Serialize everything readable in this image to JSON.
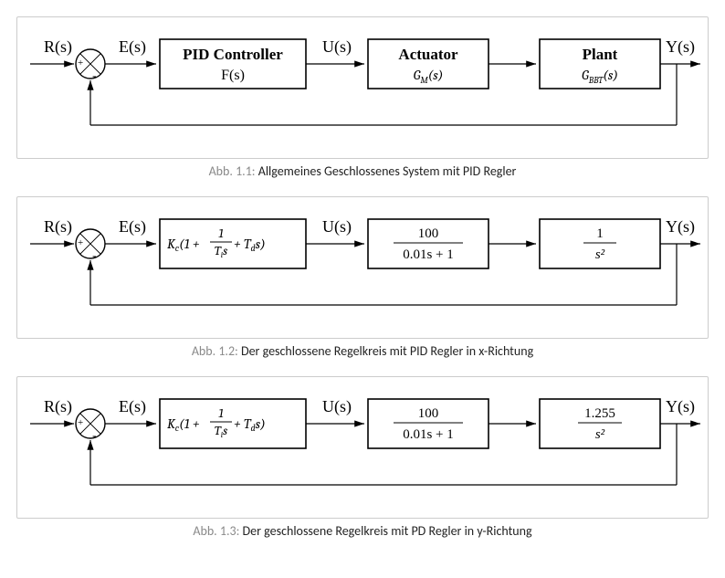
{
  "signals": {
    "input": "R(s)",
    "error": "E(s)",
    "control": "U(s)",
    "output": "Y(s)"
  },
  "d1": {
    "block1_title": "PID Controller",
    "block1_sub": "F(s)",
    "block2_title": "Actuator",
    "block2_sub_tex": "G_M(s)",
    "block3_title": "Plant",
    "block3_sub_tex": "G_BBT(s)",
    "caption_label": "Abb. 1.1:",
    "caption_text": "Allgemeines Geschlossenes System mit PID Regler"
  },
  "d2": {
    "block1_tex": "K_c(1 + 1/(T_i s) + T_d s)",
    "block2_frac_num": "100",
    "block2_frac_den": "0.01s + 1",
    "block3_frac_num": "1",
    "block3_frac_den": "s²",
    "caption_label": "Abb. 1.2:",
    "caption_text": "Der geschlossene Regelkreis mit PID Regler in x-Richtung"
  },
  "d3": {
    "block1_tex": "K_c(1 + 1/(T_i s) + T_d s)",
    "block2_frac_num": "100",
    "block2_frac_den": "0.01s + 1",
    "block3_frac_num": "1.255",
    "block3_frac_den": "s²",
    "caption_label": "Abb. 1.3:",
    "caption_text": "Der geschlossene Regelkreis mit PD Regler in y-Richtung"
  }
}
